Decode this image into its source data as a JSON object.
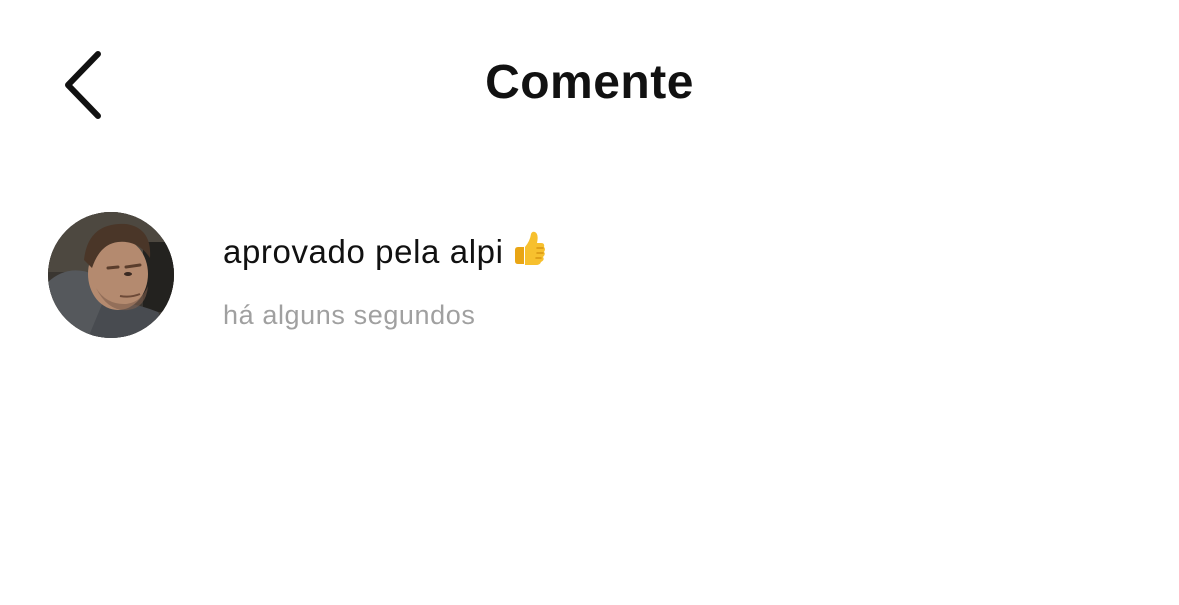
{
  "header": {
    "title": "Comente",
    "back_icon": "chevron-left-icon"
  },
  "comment": {
    "avatar_icon": "user-avatar-photo",
    "text": "aprovado pela alpi",
    "emoji": "thumbs-up-icon",
    "timestamp": "há alguns segundos"
  },
  "colors": {
    "background": "#ffffff",
    "text_primary": "#111111",
    "text_secondary": "#a0a0a0",
    "emoji_yellow": "#f5b81c"
  }
}
